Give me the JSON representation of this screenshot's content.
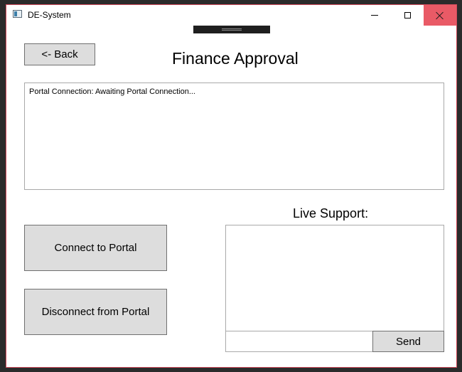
{
  "window": {
    "title": "DE-System",
    "icon": "app-icon",
    "controls": {
      "minimize_icon": "minimize-icon",
      "maximize_icon": "maximize-icon",
      "close_icon": "close-icon"
    }
  },
  "header": {
    "back_label": "<- Back",
    "title": "Finance Approval"
  },
  "log": {
    "text": "Portal Connection: Awaiting Portal Connection..."
  },
  "actions": {
    "connect_label": "Connect to Portal",
    "disconnect_label": "Disconnect from Portal"
  },
  "support": {
    "label": "Live Support:",
    "messages": "",
    "input_value": "",
    "send_label": "Send"
  },
  "colors": {
    "close_hover": "#e95a66",
    "button_bg": "#dddddd",
    "border": "#a9a9a9"
  }
}
